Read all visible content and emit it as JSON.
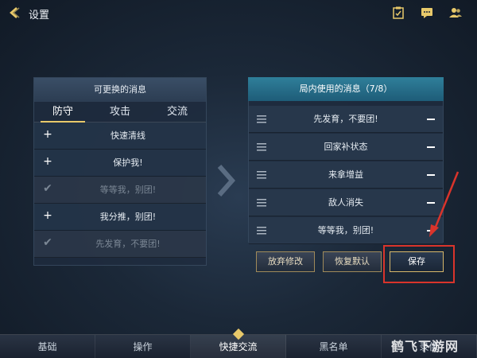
{
  "header": {
    "title": "设置",
    "icons": [
      "task-icon",
      "chat-icon",
      "friends-icon"
    ]
  },
  "left_panel": {
    "title": "可更换的消息",
    "tabs": [
      {
        "label": "防守",
        "active": true
      },
      {
        "label": "攻击",
        "active": false
      },
      {
        "label": "交流",
        "active": false
      }
    ],
    "items": [
      {
        "mark": "+",
        "text": "快速清线",
        "disabled": false
      },
      {
        "mark": "+",
        "text": "保护我!",
        "disabled": false
      },
      {
        "mark": "✔",
        "text": "等等我，别团!",
        "disabled": true
      },
      {
        "mark": "+",
        "text": "我分推，别团!",
        "disabled": false
      },
      {
        "mark": "✔",
        "text": "先发育，不要团!",
        "disabled": true
      }
    ]
  },
  "right_panel": {
    "title": "局内使用的消息（7/8）",
    "items": [
      {
        "text": "先发育，不要团!"
      },
      {
        "text": "回家补状态"
      },
      {
        "text": "来拿增益"
      },
      {
        "text": "敌人消失"
      },
      {
        "text": "等等我，别团!"
      }
    ]
  },
  "actions": {
    "discard": "放弃修改",
    "restore": "恢复默认",
    "save": "保存"
  },
  "bottom_nav": [
    {
      "label": "基础",
      "active": false
    },
    {
      "label": "操作",
      "active": false
    },
    {
      "label": "快捷交流",
      "active": true
    },
    {
      "label": "黑名单",
      "active": false
    },
    {
      "label": "录像",
      "active": false
    }
  ],
  "watermark": "鹤飞下游网",
  "colors": {
    "accent_gold": "#e8c96a",
    "highlight_red": "#d9342b",
    "header_teal": "#2f7f9a"
  }
}
